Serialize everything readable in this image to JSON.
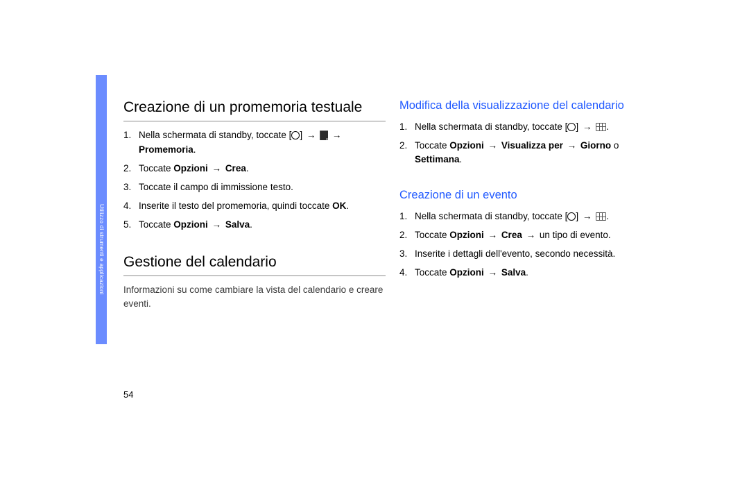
{
  "side_tab_label": "Utilizzo di strumenti e applicazioni",
  "page_number": "54",
  "left": {
    "section1_title": "Creazione di un promemoria testuale",
    "steps1": {
      "s1a": "Nella schermata di standby, toccate [",
      "s1b": "] ",
      "s1c_bold": "Promemoria",
      "s1d": ".",
      "s2a": "Toccate ",
      "s2b_bold": "Opzioni",
      "s2c": " ",
      "s2d_bold": "Crea",
      "s2e": ".",
      "s3": "Toccate il campo di immissione testo.",
      "s4a": "Inserite il testo del promemoria, quindi toccate ",
      "s4b_bold": "OK",
      "s4c": ".",
      "s5a": "Toccate ",
      "s5b_bold": "Opzioni",
      "s5c": " ",
      "s5d_bold": "Salva",
      "s5e": "."
    },
    "section2_title": "Gestione del calendario",
    "intro2": "Informazioni su come cambiare la vista del calendario e creare eventi."
  },
  "right": {
    "sub1_title": "Modifica della visualizzazione del calendario",
    "steps_sub1": {
      "s1a": "Nella schermata di standby, toccate [",
      "s1b": "] ",
      "s1c": ".",
      "s2a": "Toccate ",
      "s2b_bold": "Opzioni",
      "s2c": " ",
      "s2d_bold": "Visualizza per",
      "s2e": " ",
      "s2f_bold": "Giorno",
      "s2g": " o ",
      "s2h_bold": "Settimana",
      "s2i": "."
    },
    "sub2_title": "Creazione di un evento",
    "steps_sub2": {
      "s1a": "Nella schermata di standby, toccate [",
      "s1b": "] ",
      "s1c": ".",
      "s2a": "Toccate ",
      "s2b_bold": "Opzioni",
      "s2c": " ",
      "s2d_bold": "Crea",
      "s2e": " ",
      "s2f": " un tipo di evento.",
      "s3": "Inserite i dettagli dell'evento, secondo necessità.",
      "s4a": "Toccate ",
      "s4b_bold": "Opzioni",
      "s4c": " ",
      "s4d_bold": "Salva",
      "s4e": "."
    }
  },
  "arrow_glyph": "→"
}
